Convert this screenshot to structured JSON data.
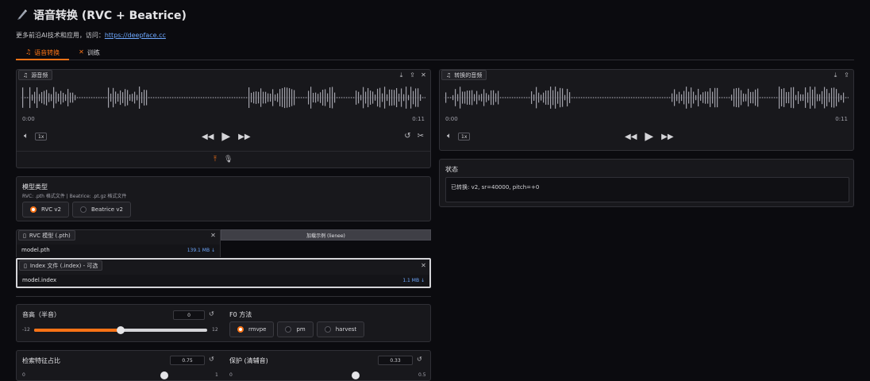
{
  "header": {
    "title": "语音转换 (RVC + Beatrice)",
    "subtitle_prefix": "更多前沿AI技术和应用，访问：",
    "subtitle_link": "https://deepface.cc"
  },
  "tabs": [
    {
      "label": "语音转换",
      "icon": "music-note-icon"
    },
    {
      "label": "训练",
      "icon": "tools-icon"
    }
  ],
  "source_audio": {
    "label": "源音频",
    "time_start": "0:00",
    "time_end": "0:11",
    "speed": "1x"
  },
  "converted_audio": {
    "label": "转换的音频",
    "time_start": "0:00",
    "time_end": "0:11",
    "speed": "1x"
  },
  "status": {
    "label": "状态",
    "text": "已转换: v2, sr=40000, pitch=+0"
  },
  "model_type": {
    "label": "模型类型",
    "hint": "RVC: .pth 格式文件 | Beatrice: .pt.gz 格式文件",
    "options": [
      "RVC v2",
      "Beatrice v2"
    ],
    "selected": "RVC v2"
  },
  "rvc_model_file": {
    "label": "RVC 模型 (.pth)",
    "filename": "model.pth",
    "size": "139.1 MB ↓"
  },
  "load_example_button": "加载示例 (lienee)",
  "index_file": {
    "label": "Index 文件 (.index) - 可选",
    "filename": "model.index",
    "size": "1.1 MB ↓"
  },
  "pitch": {
    "label": "音高（半音）",
    "value": "0",
    "min": "-12",
    "max": "12",
    "fraction": 0.5
  },
  "f0_method": {
    "label": "F0 方法",
    "options": [
      "rmvpe",
      "pm",
      "harvest"
    ],
    "selected": "rmvpe"
  },
  "index_ratio": {
    "label": "检索特征占比",
    "value": "0.75",
    "min": "0",
    "max": "1",
    "fraction": 0.75
  },
  "protect": {
    "label": "保护 (清辅音)",
    "value": "0.33",
    "min": "0",
    "max": "0.5",
    "fraction": 0.66
  },
  "colors": {
    "accent": "#f97316",
    "link": "#6ea8fe",
    "panel": "#18181c",
    "background": "#0b0b0f"
  }
}
